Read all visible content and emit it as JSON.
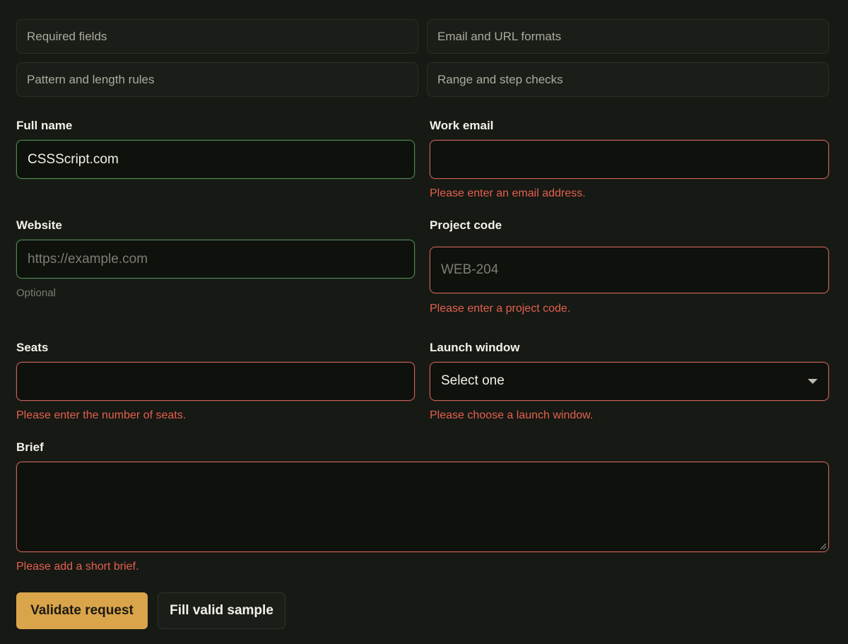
{
  "rules": [
    "Required fields",
    "Email and URL formats",
    "Pattern and length rules",
    "Range and step checks"
  ],
  "form": {
    "full_name": {
      "label": "Full name",
      "value": "CSSScript.com"
    },
    "work_email": {
      "label": "Work email",
      "value": "",
      "error": "Please enter an email address."
    },
    "website": {
      "label": "Website",
      "placeholder": "https://example.com",
      "hint": "Optional"
    },
    "project_code": {
      "label": "Project code",
      "placeholder": "WEB-204",
      "error": "Please enter a project code."
    },
    "seats": {
      "label": "Seats",
      "value": "",
      "error": "Please enter the number of seats."
    },
    "launch_window": {
      "label": "Launch window",
      "selected": "Select one",
      "error": "Please choose a launch window."
    },
    "brief": {
      "label": "Brief",
      "value": "",
      "error": "Please add a short brief."
    }
  },
  "actions": {
    "validate_label": "Validate request",
    "fill_label": "Fill valid sample"
  },
  "colors": {
    "background": "#161914",
    "accent": "#d9a44a",
    "error": "#e4604f",
    "valid_border": "#4f8a55",
    "invalid_border": "#c86258"
  }
}
